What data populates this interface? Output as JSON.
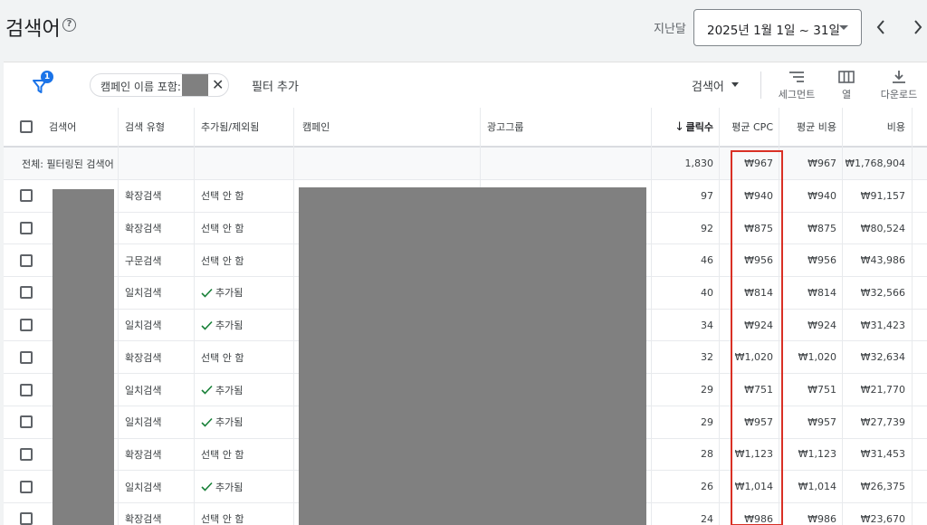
{
  "header": {
    "title": "검색어",
    "range_label": "지난달",
    "date_range": "2025년 1월 1일 ~ 31일"
  },
  "toolbar": {
    "filter_count": "1",
    "chip_label": "캠페인 이름 포함:",
    "add_filter": "필터 추가",
    "search_dropdown": "검색어",
    "segment": "세그먼트",
    "columns": "열",
    "download": "다운로드"
  },
  "table": {
    "headers": [
      "검색어",
      "검색 유형",
      "추가됨/제외됨",
      "캠페인",
      "광고그룹",
      "클릭수",
      "평균 CPC",
      "평균 비용",
      "비용"
    ],
    "sort_arrow": "↓",
    "total": {
      "label": "전체: 필터링된 검색어",
      "clicks": "1,830",
      "avg_cpc": "₩967",
      "avg_cost": "₩967",
      "cost": "₩1,768,904"
    },
    "rows": [
      {
        "type": "확장검색",
        "status": "선택 안 함",
        "added": false,
        "clicks": "97",
        "avg_cpc": "₩940",
        "avg_cost": "₩940",
        "cost": "₩91,157"
      },
      {
        "type": "확장검색",
        "status": "선택 안 함",
        "added": false,
        "clicks": "92",
        "avg_cpc": "₩875",
        "avg_cost": "₩875",
        "cost": "₩80,524"
      },
      {
        "type": "구문검색",
        "status": "선택 안 함",
        "added": false,
        "clicks": "46",
        "avg_cpc": "₩956",
        "avg_cost": "₩956",
        "cost": "₩43,986"
      },
      {
        "type": "일치검색",
        "status": "추가됨",
        "added": true,
        "clicks": "40",
        "avg_cpc": "₩814",
        "avg_cost": "₩814",
        "cost": "₩32,566"
      },
      {
        "type": "일치검색",
        "status": "추가됨",
        "added": true,
        "clicks": "34",
        "avg_cpc": "₩924",
        "avg_cost": "₩924",
        "cost": "₩31,423"
      },
      {
        "type": "확장검색",
        "status": "선택 안 함",
        "added": false,
        "clicks": "32",
        "avg_cpc": "₩1,020",
        "avg_cost": "₩1,020",
        "cost": "₩32,634"
      },
      {
        "type": "일치검색",
        "status": "추가됨",
        "added": true,
        "clicks": "29",
        "avg_cpc": "₩751",
        "avg_cost": "₩751",
        "cost": "₩21,770"
      },
      {
        "type": "일치검색",
        "status": "추가됨",
        "added": true,
        "clicks": "29",
        "avg_cpc": "₩957",
        "avg_cost": "₩957",
        "cost": "₩27,739"
      },
      {
        "type": "확장검색",
        "status": "선택 안 함",
        "added": false,
        "clicks": "28",
        "avg_cpc": "₩1,123",
        "avg_cost": "₩1,123",
        "cost": "₩31,453"
      },
      {
        "type": "일치검색",
        "status": "추가됨",
        "added": true,
        "clicks": "26",
        "avg_cpc": "₩1,014",
        "avg_cost": "₩1,014",
        "cost": "₩26,375"
      },
      {
        "type": "확장검색",
        "status": "선택 안 함",
        "added": false,
        "clicks": "24",
        "avg_cpc": "₩986",
        "avg_cost": "₩986",
        "cost": "₩23,670"
      }
    ]
  },
  "colors": {
    "accent": "#1a73e8",
    "added_check": "#188038",
    "highlight_box": "#d93025"
  }
}
